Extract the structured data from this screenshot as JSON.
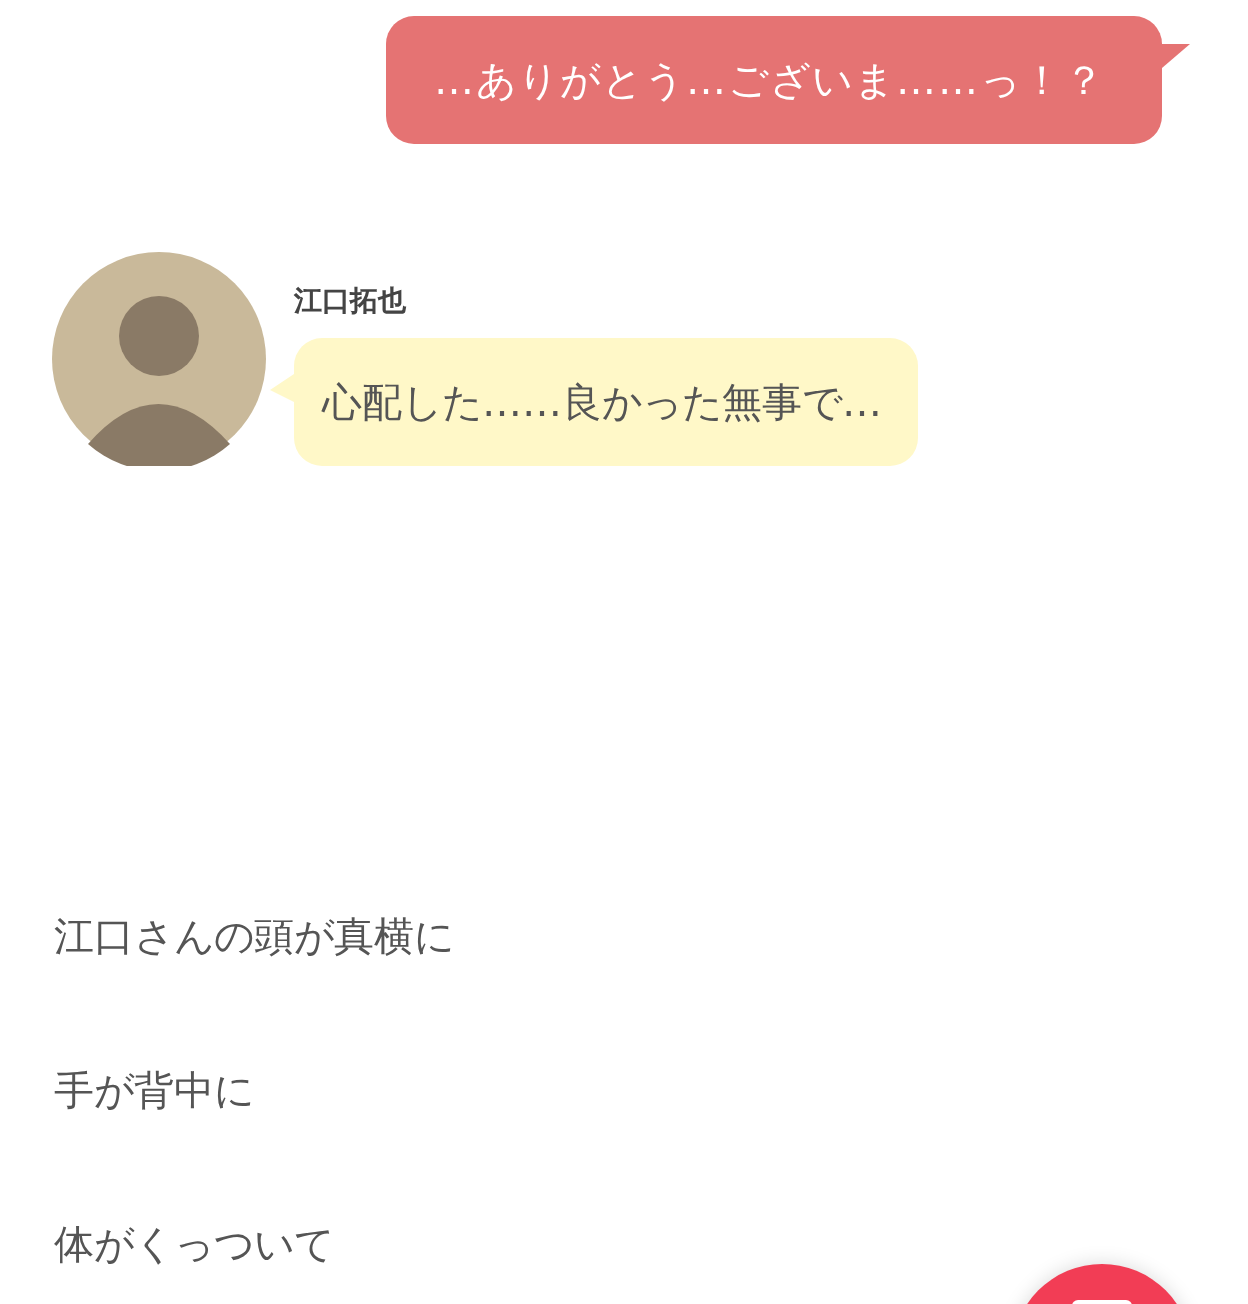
{
  "messages": [
    {
      "kind": "outgoing",
      "text": "…ありがとう…ございま……っ！？"
    },
    {
      "kind": "incoming",
      "speaker": "江口拓也",
      "text": "心配した……良かった無事で…"
    }
  ],
  "narration": [
    "江口さんの頭が真横に",
    "手が背中に",
    "体がくっついて"
  ],
  "floating_button": {
    "kind": "compose"
  }
}
